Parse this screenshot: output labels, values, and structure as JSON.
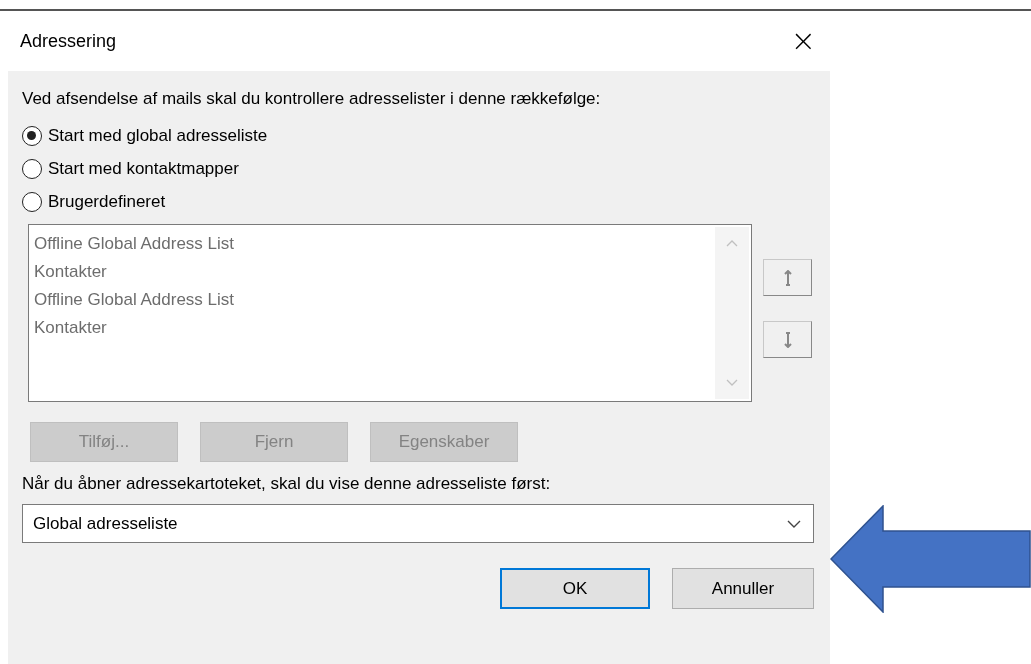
{
  "window": {
    "title": "Adressering",
    "close": "×"
  },
  "order_label": "Ved afsendelse af mails skal du kontrollere adresselister i denne rækkefølge:",
  "options": [
    {
      "label": "Start med global adresseliste",
      "selected": true
    },
    {
      "label": "Start med kontaktmapper",
      "selected": false
    },
    {
      "label": "Brugerdefineret",
      "selected": false
    }
  ],
  "list": {
    "disabled": true,
    "items": [
      "Offline Global Address List",
      "Kontakter",
      "Offline Global Address List",
      "Kontakter"
    ]
  },
  "list_buttons": [
    {
      "label": "Tilføj...",
      "disabled": true
    },
    {
      "label": "Fjern",
      "disabled": true
    },
    {
      "label": "Egenskaber",
      "disabled": true
    }
  ],
  "first_label": "Når du åbner adressekartoteket, skal du vise denne adresseliste først:",
  "first_list": {
    "value": "Global adresseliste"
  },
  "buttons": [
    {
      "label": "OK",
      "default": true
    },
    {
      "label": "Annuller",
      "default": false
    }
  ]
}
